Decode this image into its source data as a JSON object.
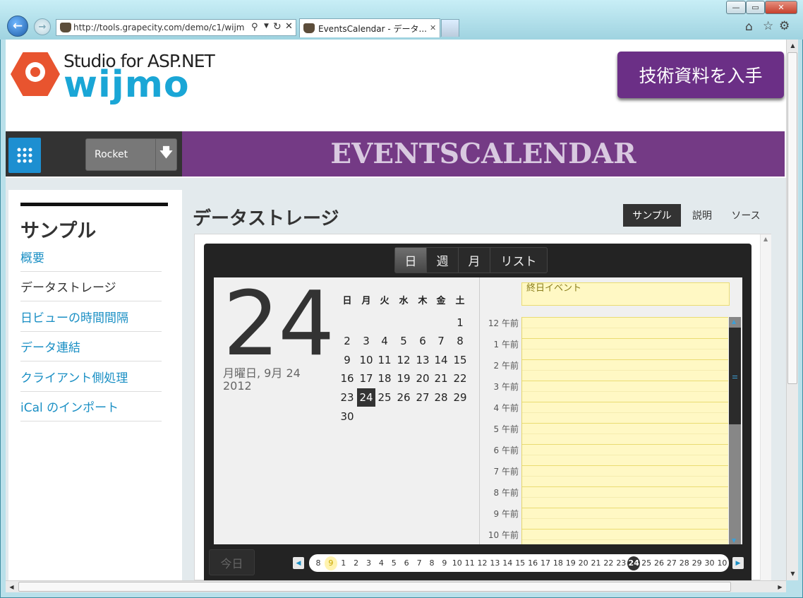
{
  "browser": {
    "url": "http://tools.grapecity.com/demo/c1/wijm",
    "tab_title": "EventsCalendar - データ...",
    "window_buttons": [
      "—",
      "▭",
      "✕"
    ]
  },
  "header": {
    "logo_line1": "Studio for ASP.NET",
    "logo_line2": "wijmo",
    "cta_label": "技術資料を入手"
  },
  "topbar": {
    "product": "Rocket",
    "banner_title": "EVENTSCALENDAR"
  },
  "sidebar": {
    "title": "サンプル",
    "items": [
      {
        "label": "概要"
      },
      {
        "label": "データストレージ"
      },
      {
        "label": "日ビューの時間間隔"
      },
      {
        "label": "データ連結"
      },
      {
        "label": "クライアント側処理"
      },
      {
        "label": "iCal のインポート"
      }
    ]
  },
  "main": {
    "title": "データストレージ",
    "tabs": [
      {
        "label": "サンプル"
      },
      {
        "label": "説明"
      },
      {
        "label": "ソース"
      }
    ]
  },
  "calendar": {
    "view_tabs": [
      {
        "label": "日"
      },
      {
        "label": "週"
      },
      {
        "label": "月"
      },
      {
        "label": "リスト"
      }
    ],
    "big_day": "24",
    "date_line1": "月曜日, 9月 24",
    "date_line2": "2012",
    "weekdays": [
      "日",
      "月",
      "火",
      "水",
      "木",
      "金",
      "土"
    ],
    "weeks": [
      [
        "",
        "",
        "",
        "",
        "",
        "",
        "1"
      ],
      [
        "2",
        "3",
        "4",
        "5",
        "6",
        "7",
        "8"
      ],
      [
        "9",
        "10",
        "11",
        "12",
        "13",
        "14",
        "15"
      ],
      [
        "16",
        "17",
        "18",
        "19",
        "20",
        "21",
        "22"
      ],
      [
        "23",
        "24",
        "25",
        "26",
        "27",
        "28",
        "29"
      ],
      [
        "30",
        "",
        "",
        "",
        "",
        "",
        ""
      ]
    ],
    "allday_label": "終日イベント",
    "hours": [
      "12 午前",
      "1 午前",
      "2 午前",
      "3 午前",
      "4 午前",
      "5 午前",
      "6 午前",
      "7 午前",
      "8 午前",
      "9 午前",
      "10 午前"
    ],
    "today_button": "今日",
    "strip_days": [
      "8",
      "9",
      "1",
      "2",
      "3",
      "4",
      "5",
      "6",
      "7",
      "8",
      "9",
      "10",
      "11",
      "12",
      "13",
      "14",
      "15",
      "16",
      "17",
      "18",
      "19",
      "20",
      "21",
      "22",
      "23",
      "24",
      "25",
      "26",
      "27",
      "28",
      "29",
      "30",
      "10"
    ],
    "prev_icon": "arrow-left-icon",
    "next_icon": "arrow-right-icon"
  }
}
